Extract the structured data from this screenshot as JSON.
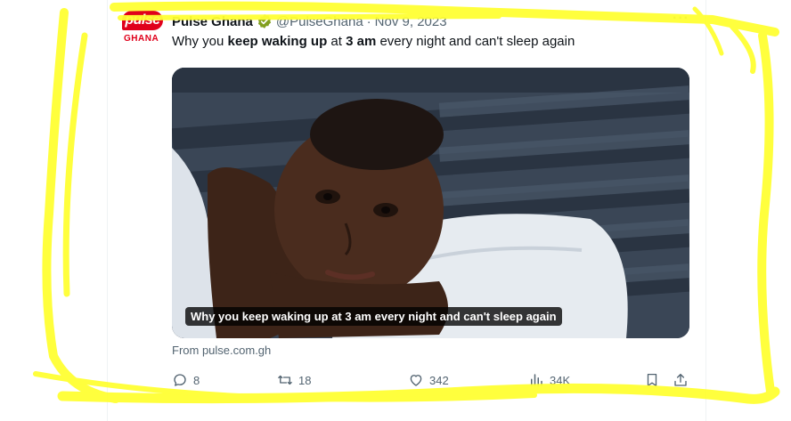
{
  "tweet": {
    "display_name": "Pulse Ghana",
    "handle": "@PulseGhana",
    "separator": "·",
    "date": "Nov 9, 2023",
    "more_label": "···",
    "text_parts": {
      "p1": "Why you ",
      "b1": "keep waking up",
      "p2": " at ",
      "b2": "3 am",
      "p3": " every night and can't sleep again"
    },
    "media_caption": "Why you keep waking up at 3 am every night and can't sleep again",
    "source": "From pulse.com.gh"
  },
  "avatar": {
    "logo_top": "pulse",
    "logo_bottom": "GHANA"
  },
  "actions": {
    "replies": "8",
    "reposts": "18",
    "likes": "342",
    "views": "34K"
  },
  "icons": {
    "verified": "verified-badge-icon",
    "reply": "reply-icon",
    "repost": "repost-icon",
    "like": "heart-icon",
    "views": "views-chart-icon",
    "bookmark": "bookmark-icon",
    "share": "share-icon"
  },
  "colors": {
    "verified_green": "#829f1f",
    "brand_red": "#e0001b",
    "secondary_text": "#536471",
    "highlight_yellow": "#ffff33"
  }
}
